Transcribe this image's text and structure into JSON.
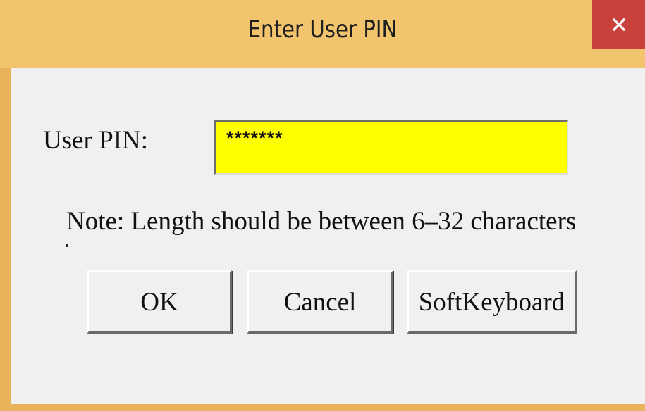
{
  "window": {
    "title": "Enter User PIN",
    "close_glyph": "X",
    "titlebar_color": "#f2c46e",
    "close_color": "#c8413c"
  },
  "form": {
    "pin_label": "User PIN:",
    "pin_value": "*******",
    "input_background": "#ffff00",
    "note": "Note: Length should be between 6–32 characters"
  },
  "buttons": {
    "ok": "OK",
    "cancel": "Cancel",
    "soft_keyboard": "SoftKeyboard"
  }
}
